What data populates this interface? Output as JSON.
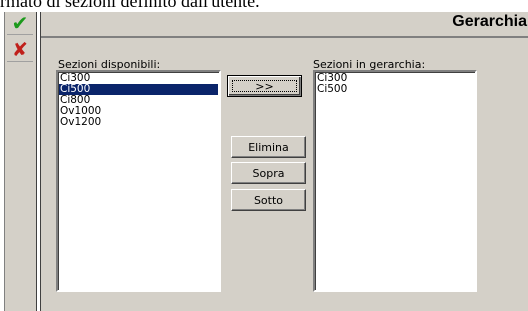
{
  "caption_fragment": "rmato di sezioni definito dall'utente.",
  "toolbar": {
    "ok_icon": "check-icon",
    "cancel_icon": "x-icon",
    "ok_glyph": "✔",
    "cancel_glyph": "✘"
  },
  "panel": {
    "title": "Gerarchia"
  },
  "available": {
    "label": "Sezioni disponibili:",
    "items": [
      "Ci300",
      "Ci500",
      "Ci800",
      "Ov1000",
      "Ov1200"
    ],
    "selected_index": 1
  },
  "hierarchy": {
    "label": "Sezioni in gerarchia:",
    "items": [
      "Ci300",
      "Ci500"
    ]
  },
  "buttons": {
    "add": ">>",
    "delete": "Elimina",
    "up": "Sopra",
    "down": "Sotto"
  },
  "colors": {
    "selection": "#0a246a",
    "ok": "#1c9a1c",
    "cancel": "#c0201b",
    "face": "#d4d0c8"
  }
}
